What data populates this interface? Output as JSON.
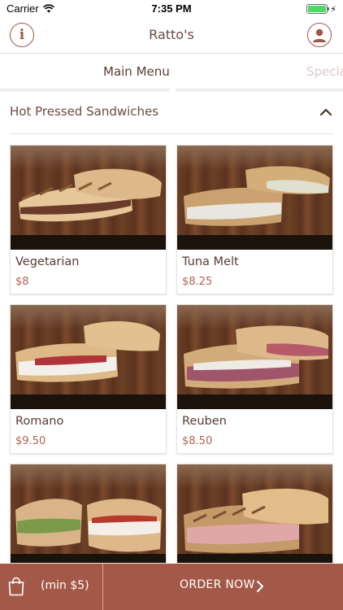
{
  "status": {
    "carrier": "Carrier",
    "time": "7:35 PM",
    "battery_level": 1.0,
    "battery_color": "#4cd964"
  },
  "nav": {
    "title": "Ratto's",
    "left_icon": "info-icon",
    "right_icon": "user-icon",
    "accent": "#a0564a"
  },
  "tabs": [
    {
      "label": "Main Menu",
      "selected": true
    },
    {
      "label": "Specials",
      "selected": false
    }
  ],
  "section": {
    "title": "Hot Pressed Sandwiches",
    "expanded": true
  },
  "items": [
    {
      "name": "Vegetarian",
      "price": "$8"
    },
    {
      "name": "Tuna Melt",
      "price": "$8.25"
    },
    {
      "name": "Romano",
      "price": "$9.50"
    },
    {
      "name": "Reuben",
      "price": "$8.50"
    },
    {
      "name": "",
      "price": ""
    },
    {
      "name": "",
      "price": ""
    }
  ],
  "cart": {
    "minimum": "(min $5)",
    "order_label": "ORDER NOW",
    "bar_color": "#a45948"
  }
}
